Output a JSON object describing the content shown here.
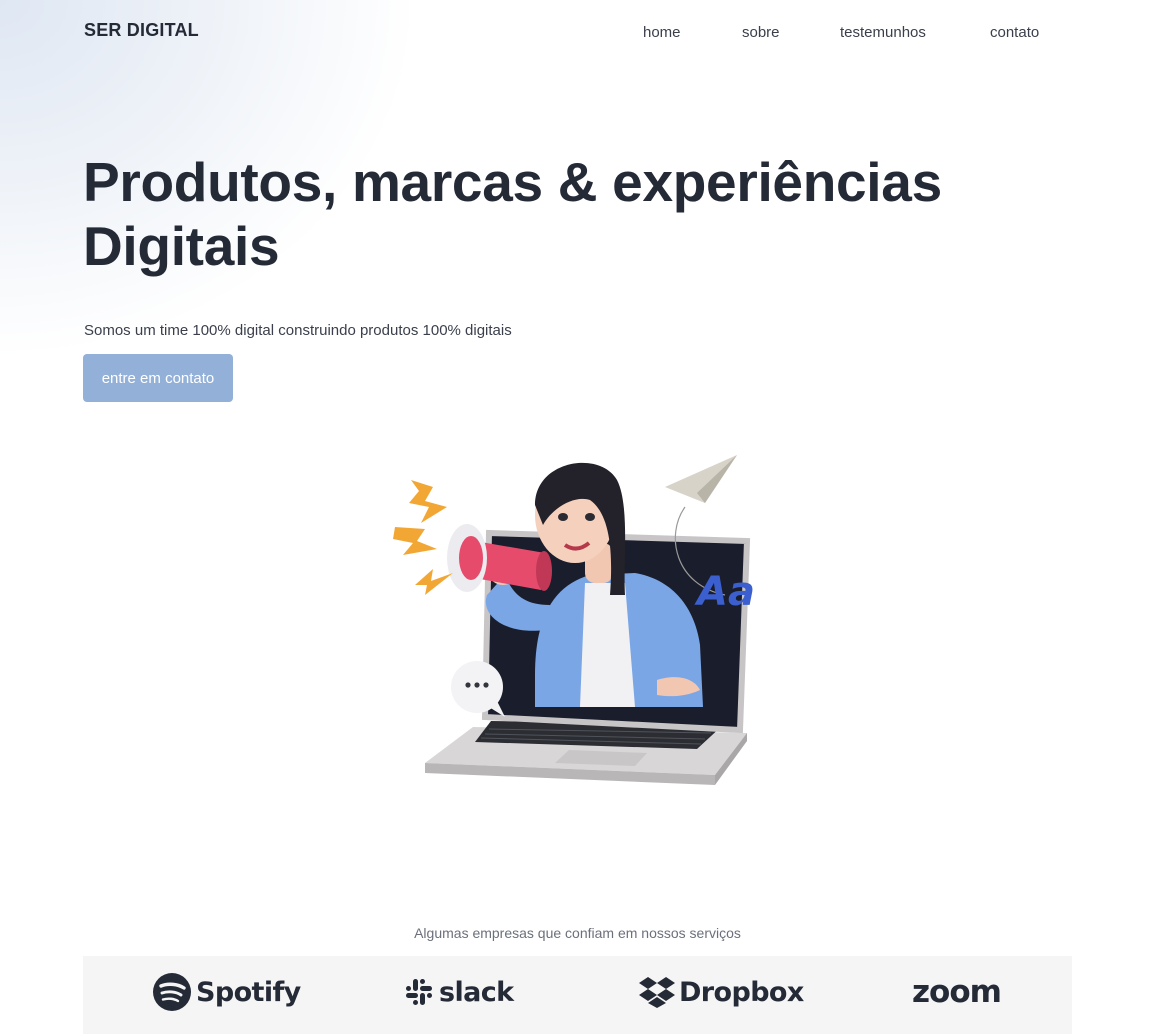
{
  "brand": {
    "name": "SER DIGITAL"
  },
  "nav": {
    "items": [
      {
        "label": "home"
      },
      {
        "label": "sobre"
      },
      {
        "label": "testemunhos"
      },
      {
        "label": "contato"
      }
    ]
  },
  "hero": {
    "headline_line1": "Produtos, marcas & experiências",
    "headline_line2": "Digitais",
    "subtitle": "Somos um time 100% digital construindo produtos 100% digitais",
    "cta_label": "entre em contato",
    "illustration_text": "Aa"
  },
  "partners": {
    "caption": "Algumas empresas que confiam em nossos serviços",
    "logos": [
      {
        "name": "Spotify",
        "icon": "spotify-icon"
      },
      {
        "name": "slack",
        "icon": "slack-icon"
      },
      {
        "name": "Dropbox",
        "icon": "dropbox-icon"
      },
      {
        "name": "zoom",
        "icon": "zoom-icon"
      }
    ]
  },
  "colors": {
    "text_dark": "#252a37",
    "accent_button": "#93b0d8",
    "logo_strip_bg": "#f5f5f6"
  }
}
